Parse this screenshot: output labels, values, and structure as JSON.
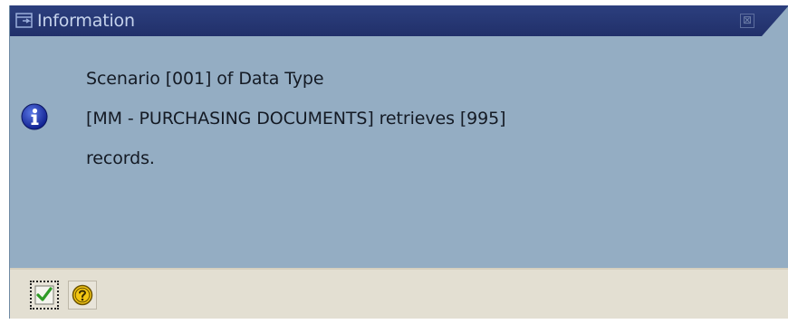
{
  "window": {
    "title": "Information",
    "close_label": "⊠"
  },
  "message": {
    "lines": [
      "Scenario [001] of Data Type",
      "[MM - PURCHASING DOCUMENTS] retrieves [995]",
      "records."
    ]
  },
  "footer": {
    "buttons": [
      {
        "name": "confirm",
        "icon": "green-checkmark-icon"
      },
      {
        "name": "help",
        "icon": "question-mark-icon"
      }
    ]
  },
  "colors": {
    "titlebar": "#21306a",
    "title_text": "#c6d3ec",
    "content_bg": "#94adc3",
    "footer_bg": "#e3dfd2",
    "info_icon": "#1a2fa8",
    "check_green": "#2e9a25",
    "help_yellow": "#f3c613"
  }
}
